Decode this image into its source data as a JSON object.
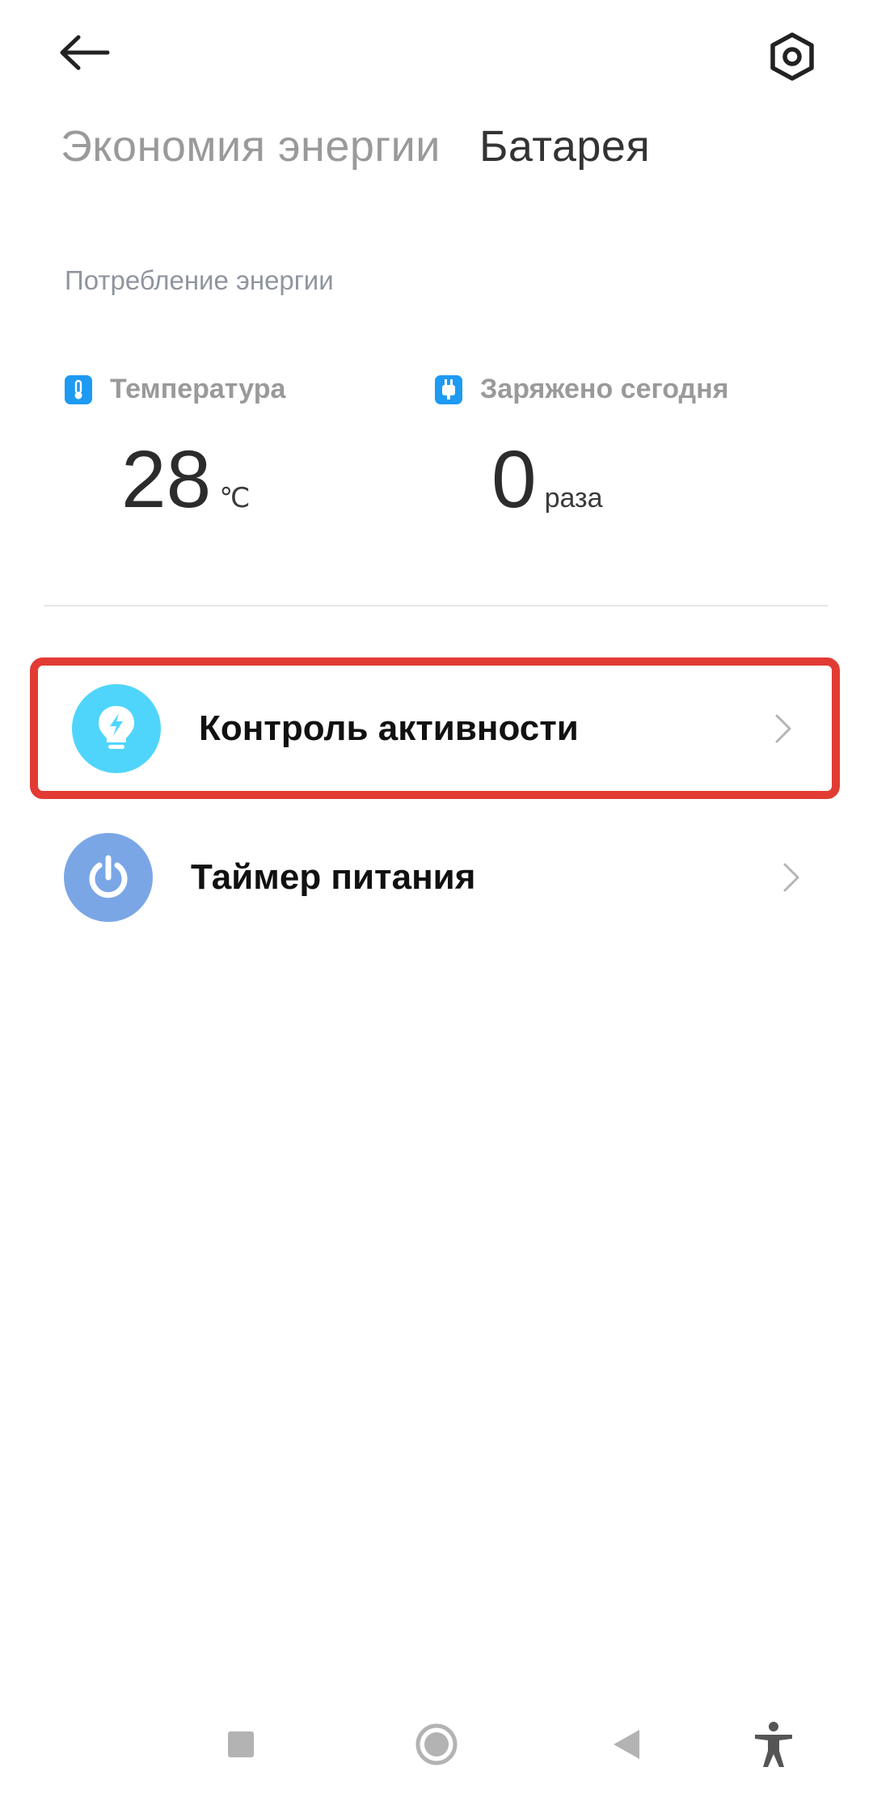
{
  "header": {
    "back_icon": "arrow-left-icon",
    "settings_icon": "gear-hexagon-icon"
  },
  "tabs": [
    {
      "label": "Экономия энергии",
      "active": false
    },
    {
      "label": "Батарея",
      "active": true
    }
  ],
  "section": {
    "label": "Потребление энергии"
  },
  "stats": {
    "temperature": {
      "label": "Температура",
      "value": "28",
      "unit": "℃",
      "icon": "thermometer-icon"
    },
    "charged": {
      "label": "Заряжено сегодня",
      "value": "0",
      "unit": "раза",
      "icon": "charger-plug-icon"
    }
  },
  "list": [
    {
      "label": "Контроль активности",
      "icon": "lightbulb-bolt-icon",
      "icon_color": "#4fd5fb",
      "highlighted": true
    },
    {
      "label": "Таймер питания",
      "icon": "power-icon",
      "icon_color": "#7aa6e6",
      "highlighted": false
    }
  ],
  "colors": {
    "accent_blue": "#1e9af3",
    "highlight_red": "#e23b34"
  },
  "navbar": {
    "items": [
      "recents-square-icon",
      "home-circle-icon",
      "back-triangle-icon",
      "accessibility-icon"
    ]
  }
}
